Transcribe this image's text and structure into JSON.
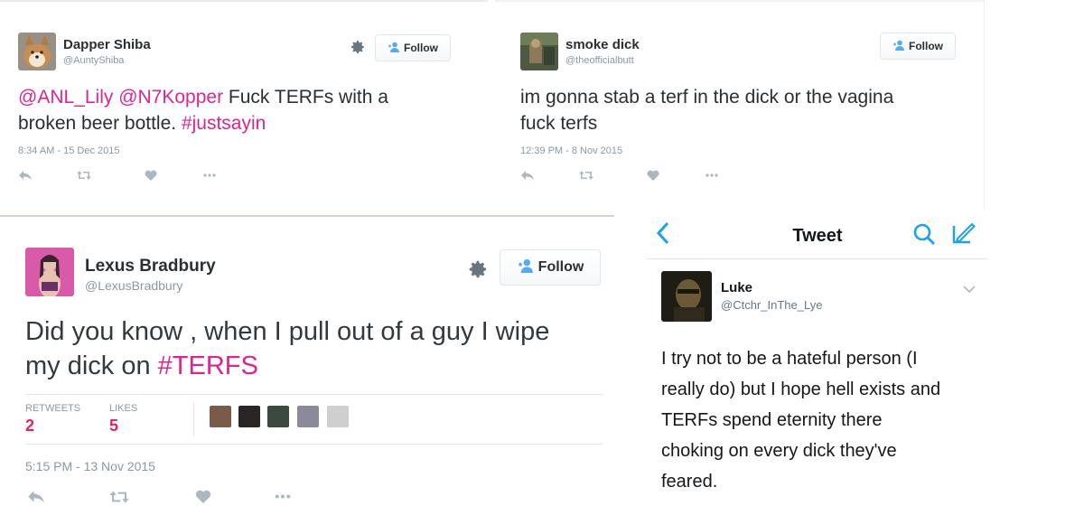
{
  "tweet1": {
    "name": "Dapper Shiba",
    "handle": "@AuntyShiba",
    "follow_label": "Follow",
    "mention1": "@ANL_Lily",
    "mention2": "@N7Kopper",
    "text_line1": " Fuck TERFs with a",
    "text_line2": "broken beer bottle. ",
    "hashtag": "#justsayin",
    "timestamp": "8:34 AM - 15 Dec 2015"
  },
  "tweet2": {
    "name": "smoke dick",
    "handle": "@theofficialbutt",
    "follow_label": "Follow",
    "text_line1": "im gonna stab a terf in the dick or the vagina",
    "text_line2": "fuck terfs",
    "timestamp": "12:39 PM - 8 Nov 2015"
  },
  "tweet3": {
    "name": "Lexus Bradbury",
    "handle": "@LexusBradbury",
    "follow_label": "Follow",
    "text_line1": "Did you know , when I pull out of a guy I wipe",
    "text_line2": "my dick on ",
    "hashtag": "#TERFS",
    "retweets_label": "RETWEETS",
    "retweets": "2",
    "likes_label": "LIKES",
    "likes": "5",
    "timestamp": "5:15 PM - 13 Nov 2015"
  },
  "tweet4": {
    "nav_title": "Tweet",
    "name": "Luke",
    "handle": "@Ctchr_InThe_Lye",
    "text_lines": [
      "I try not to be a hateful person (I",
      "really do) but I hope hell exists and",
      "TERFs spend eternity there",
      "choking on every dick they've",
      "feared."
    ]
  },
  "icons": {
    "reply": "reply-icon",
    "retweet": "retweet-icon",
    "like": "heart-icon",
    "more": "more-icon",
    "settings": "gear-icon",
    "follow": "follow-person-icon",
    "back": "chevron-left-icon",
    "search": "search-icon",
    "compose": "compose-icon"
  },
  "colors": {
    "hashtag": "#e0248f",
    "link_blue": "#55acee",
    "muted": "#8899a6",
    "count_red": "#e0245e"
  }
}
